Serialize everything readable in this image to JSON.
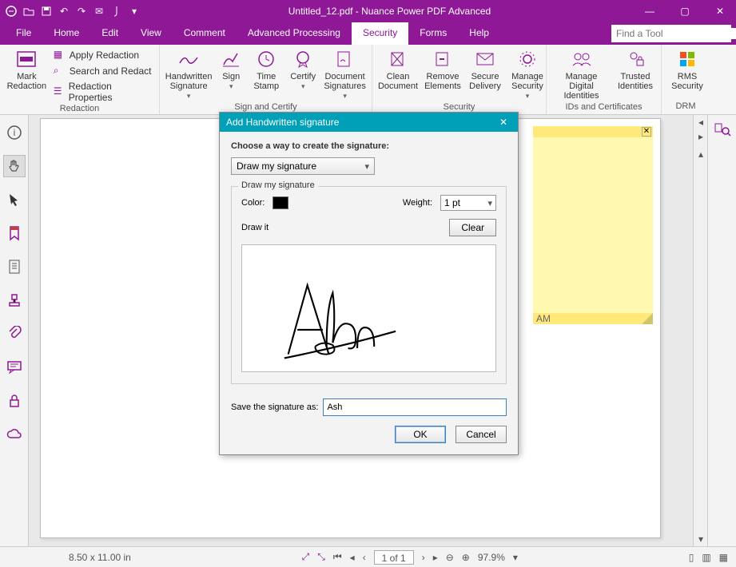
{
  "app": {
    "title": "Untitled_12.pdf - Nuance Power PDF Advanced"
  },
  "menu": {
    "items": [
      "File",
      "Home",
      "Edit",
      "View",
      "Comment",
      "Advanced Processing",
      "Security",
      "Forms",
      "Help"
    ],
    "active": "Security",
    "find_placeholder": "Find a Tool"
  },
  "ribbon": {
    "redaction": {
      "label": "Redaction",
      "mark": "Mark\nRedaction",
      "items": [
        "Apply Redaction",
        "Search and Redact",
        "Redaction Properties"
      ]
    },
    "sign": {
      "label": "Sign and Certify",
      "handwritten": "Handwritten\nSignature",
      "sign": "Sign",
      "timestamp": "Time\nStamp",
      "certify": "Certify",
      "docsig": "Document\nSignatures"
    },
    "security": {
      "label": "Security",
      "clean": "Clean\nDocument",
      "remove": "Remove\nElements",
      "secure": "Secure\nDelivery",
      "manage": "Manage\nSecurity"
    },
    "ids": {
      "label": "IDs and Certificates",
      "managedig": "Manage Digital\nIdentities",
      "trusted": "Trusted\nIdentities"
    },
    "drm": {
      "label": "DRM",
      "rms": "RMS\nSecurity"
    }
  },
  "sticky": {
    "time": "AM"
  },
  "status": {
    "dims": "8.50 x 11.00 in",
    "page": "1 of 1",
    "zoom": "97.9%"
  },
  "dialog": {
    "title": "Add Handwritten signature",
    "choose": "Choose a way to create the signature:",
    "method": "Draw my signature",
    "legend": "Draw my signature",
    "color": "Color:",
    "weight": "Weight:",
    "weight_val": "1 pt",
    "drawit": "Draw it",
    "clear": "Clear",
    "save_label": "Save the signature as:",
    "save_value": "Ash",
    "ok": "OK",
    "cancel": "Cancel"
  }
}
